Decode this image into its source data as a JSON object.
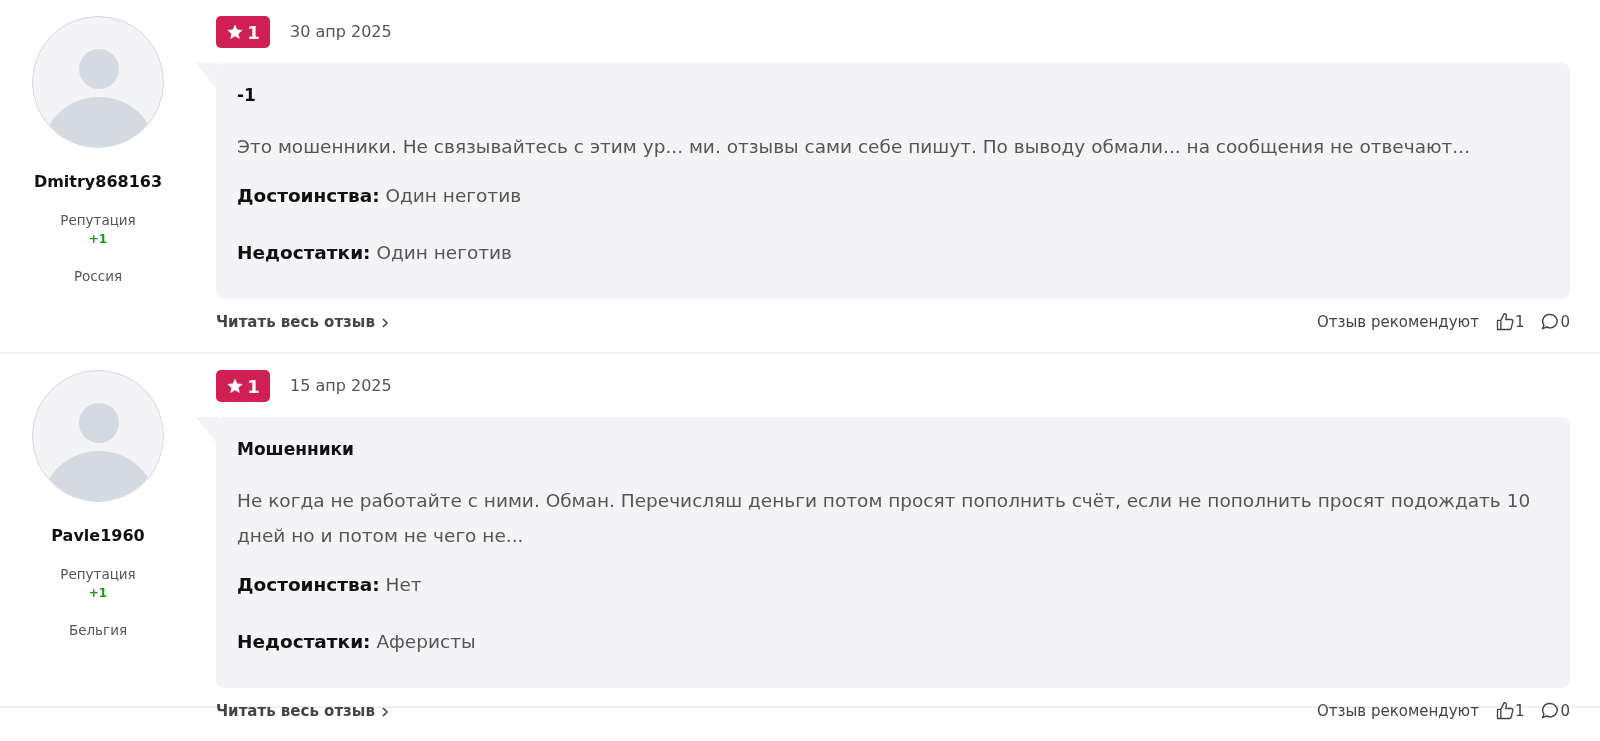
{
  "reviews": [
    {
      "author": "Dmitry868163",
      "reputation_label": "Репутация",
      "reputation": "+1",
      "country": "Россия",
      "rating": "1",
      "date": "30 апр 2025",
      "title": "-1",
      "text": "Это мошенники. Не связывайтесь с этим ур... ми. отзывы сами себе пишут. По выводу обмали... на сообщения не отвечают...",
      "pros_label": "Достоинства:",
      "pros": "Один неготив",
      "cons_label": "Недостатки:",
      "cons": "Один неготив",
      "read_more": "Читать весь отзыв",
      "recommend_label": "Отзыв рекомендуют",
      "likes": "1",
      "comments": "0"
    },
    {
      "author": "Pavle1960",
      "reputation_label": "Репутация",
      "reputation": "+1",
      "country": "Бельгия",
      "rating": "1",
      "date": "15 апр 2025",
      "title": "Мошенники",
      "text": "Не когда не работайте с ними. Обман. Перечисляш деньги потом просят пополнить счёт, если не пополнить просят подождать 10 дней но и потом не чего не...",
      "pros_label": "Достоинства:",
      "pros": "Нет",
      "cons_label": "Недостатки:",
      "cons": "Аферисты",
      "read_more": "Читать весь отзыв",
      "recommend_label": "Отзыв рекомендуют",
      "likes": "1",
      "comments": "0"
    }
  ]
}
